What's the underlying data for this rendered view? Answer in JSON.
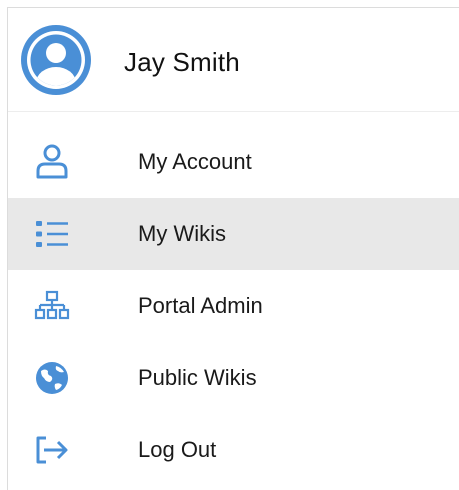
{
  "user": {
    "name": "Jay Smith",
    "avatar_icon": "user-avatar-icon"
  },
  "accent_color": "#4a8fd6",
  "active_background": "#e8e8e8",
  "menu": {
    "items": [
      {
        "id": "my-account",
        "label": "My Account",
        "icon": "user-outline-icon",
        "active": false
      },
      {
        "id": "my-wikis",
        "label": "My Wikis",
        "icon": "list-icon",
        "active": true
      },
      {
        "id": "portal-admin",
        "label": "Portal Admin",
        "icon": "sitemap-icon",
        "active": false
      },
      {
        "id": "public-wikis",
        "label": "Public Wikis",
        "icon": "globe-icon",
        "active": false
      },
      {
        "id": "log-out",
        "label": "Log Out",
        "icon": "logout-icon",
        "active": false
      }
    ]
  }
}
